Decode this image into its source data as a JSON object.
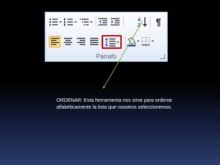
{
  "ribbon": {
    "group_label": "Párrafo",
    "icons": {
      "bullets": "bullet-list-icon",
      "numbering": "numbered-list-icon",
      "multilevel": "multilevel-list-icon",
      "decrease_indent": "decrease-indent-icon",
      "increase_indent": "increase-indent-icon",
      "sort": "sort-az-icon",
      "show_marks": "pilcrow-icon",
      "align_left": "align-left-icon",
      "center": "align-center-icon",
      "align_right": "align-right-icon",
      "justify": "justify-icon",
      "line_spacing": "line-spacing-icon",
      "shading": "shading-bucket-icon",
      "borders": "borders-icon",
      "launcher": "dialog-launcher-icon"
    }
  },
  "callout": {
    "text": "ORDENAR:  Esta herramienta nos sirve para ordenar alfabéticamente la lista que nosotros seleccionemos."
  },
  "colors": {
    "highlight_box": "#c00000",
    "pointer_line": "#6abf3a",
    "selected_button": "#fbe08a"
  }
}
